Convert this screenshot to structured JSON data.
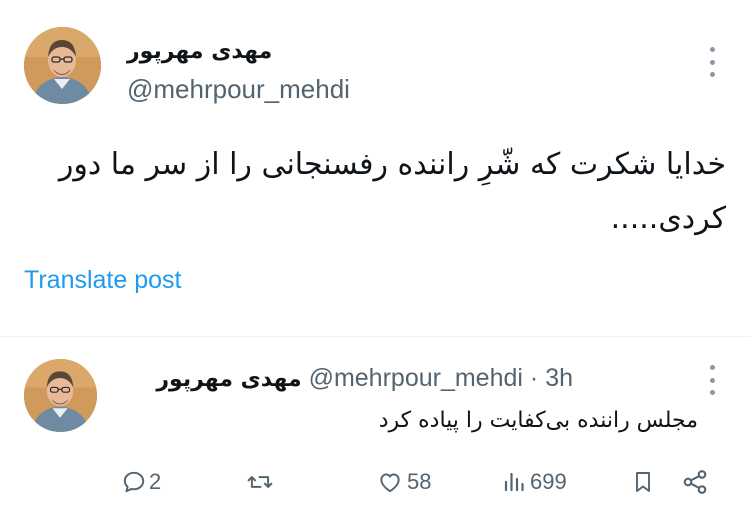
{
  "tweet": {
    "author_name": "مهدی مهرپور",
    "handle": "@mehrpour_mehdi",
    "text_line1": "خدایا شکرت که شّرِ راننده رفسنجانی را از سر ما دور",
    "text_line2": "کردی.....",
    "translate_label": "Translate post"
  },
  "reply": {
    "author_name": "مهدی مهرپور",
    "handle": "@mehrpour_mehdi",
    "separator": "·",
    "time": "3h",
    "text": "مجلس راننده بی‌کفایت را پیاده کرد"
  },
  "actions": {
    "reply_count": "2",
    "retweet_count": "",
    "like_count": "58",
    "views_count": "699"
  },
  "icons": {
    "more": "more-icon",
    "reply": "reply-icon",
    "retweet": "retweet-icon",
    "like": "heart-icon",
    "views": "views-icon",
    "bookmark": "bookmark-icon",
    "share": "share-icon"
  },
  "colors": {
    "link": "#1d9bf0",
    "muted": "#536471",
    "text": "#0f1419"
  }
}
